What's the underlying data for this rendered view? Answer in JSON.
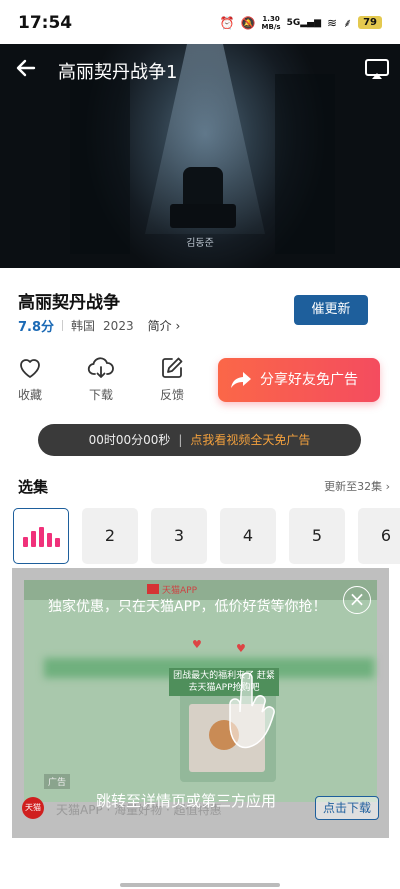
{
  "status_bar": {
    "time": "17:54",
    "net_speed_value": "1.30",
    "net_speed_unit": "MB/s",
    "network": "5G",
    "battery": "79"
  },
  "player": {
    "title": "高丽契丹战争1",
    "subtitle_caption": "김동준"
  },
  "show": {
    "title": "高丽契丹战争",
    "rating": "7.8分",
    "region": "韩国",
    "year": "2023",
    "intro_label": "简介",
    "urge_update_label": "催更新"
  },
  "actions": {
    "favorite_label": "收藏",
    "download_label": "下载",
    "feedback_label": "反馈",
    "share_label": "分享好友免广告"
  },
  "timer": {
    "countdown": "00时00分00秒",
    "separator": "|",
    "cta": "点我看视频全天免广告"
  },
  "episodes": {
    "header": "选集",
    "update_status": "更新至32集",
    "items": [
      "2",
      "3",
      "4",
      "5",
      "6"
    ]
  },
  "ad": {
    "tmall_tag": "天猫APP",
    "promo_text": "独家优惠，只在天猫APP，低价好货等你抢！",
    "inner_caption": "团战最大的福利来了 赶紧去天猫APP抢购吧",
    "ad_label": "广告",
    "brand_logo_text": "天猫",
    "brand_line": "天猫APP · 海量好物 · 超值特惠",
    "jump_text": "跳转至详情页或第三方应用",
    "download_label": "点击下载"
  },
  "colors": {
    "accent_blue": "#1e5f9c",
    "share_gradient_start": "#fb6748",
    "share_gradient_end": "#f44c5f",
    "playing_bars": "#f0317a",
    "timer_cta": "#f2a03d"
  }
}
